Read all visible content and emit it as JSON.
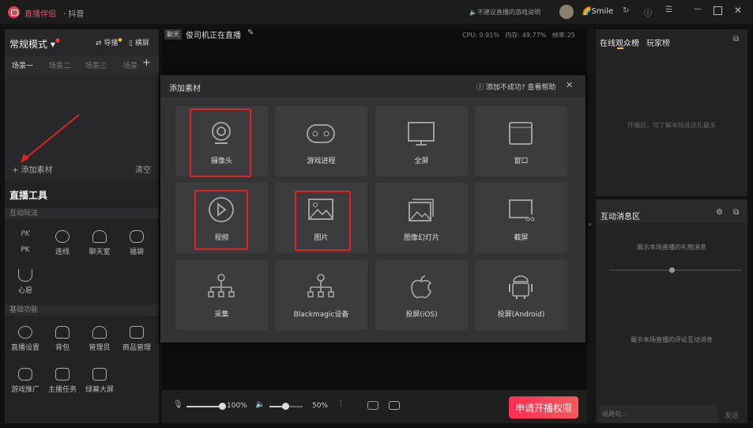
{
  "titlebar": {
    "app_name": "直播伴侣",
    "platform": "· 抖音",
    "notice": "不建议直播的游戏说明",
    "username": "Smile"
  },
  "left": {
    "mode": "常规模式",
    "guide": "导播",
    "landscape": "横屏",
    "scenes": [
      "场景一",
      "场景二",
      "场景三",
      "场景"
    ],
    "add_source": "添加素材",
    "clear": "清空",
    "tools_title": "直播工具",
    "section_interactive": "互动玩法",
    "interactive": [
      "PK",
      "连线",
      "聊天室",
      "福袋",
      "心愿"
    ],
    "section_basic": "基础功能",
    "basic": [
      "直播设置",
      "背包",
      "管理员",
      "商品管理",
      "游戏推广",
      "主播任务",
      "绿幕大屏"
    ]
  },
  "center": {
    "chat_tag": "聊天",
    "stream_title": "俊司机正在直播",
    "stats": "CPU: 0.91%   内存: 49.77%   帧率:25",
    "mic_volume": "100%",
    "speaker_volume": "50%",
    "mic_level": 1.0,
    "speaker_level": 0.5,
    "apply_button": "申请开播权限"
  },
  "dialog": {
    "title": "添加素材",
    "help": "添加不成功? 查看帮助",
    "tiles": [
      "摄像头",
      "游戏进程",
      "全屏",
      "窗口",
      "视频",
      "图片",
      "图像幻灯片",
      "截屏",
      "采集",
      "Blackmagic设备",
      "投屏(iOS)",
      "投屏(Android)"
    ],
    "highlighted": [
      "摄像头",
      "视频",
      "图片"
    ]
  },
  "right": {
    "tab_online": "在线观众榜",
    "tab_players": "玩家榜",
    "rank_hint": "开播后，可了解本场谁送礼最多",
    "interact_title": "互动消息区",
    "gift_hint": "展示本场直播的礼物消息",
    "comment_hint": "展示本场直播的评论互动消息",
    "input_placeholder": "说两句...",
    "send": "发送"
  },
  "colors": {
    "accent": "#fe2c55",
    "highlight": "#e02424",
    "annotation_arrow": "#e02424"
  }
}
